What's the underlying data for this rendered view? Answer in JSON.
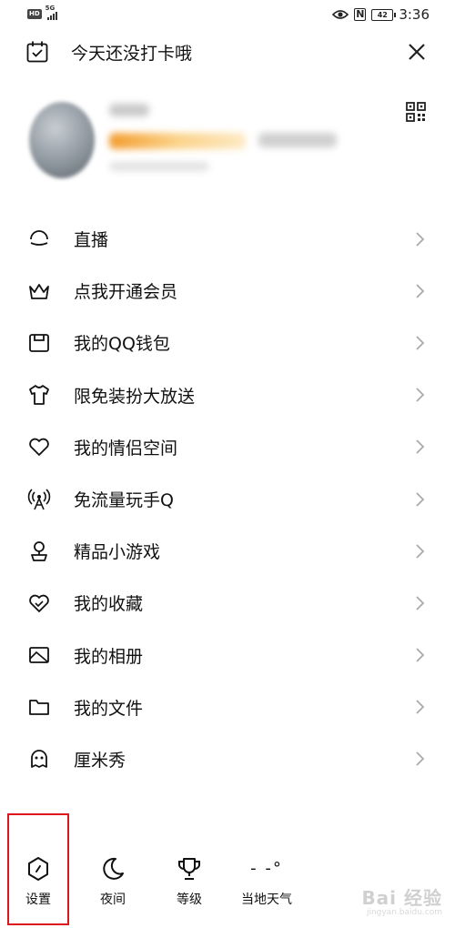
{
  "status_bar": {
    "hd": "HD",
    "network": "5G",
    "battery": "42",
    "time": "3:36"
  },
  "checkin": {
    "text": "今天还没打卡哦"
  },
  "menu": {
    "items": [
      {
        "label": "直播",
        "icon": "live-icon"
      },
      {
        "label": "点我开通会员",
        "icon": "crown-icon"
      },
      {
        "label": "我的QQ钱包",
        "icon": "wallet-icon"
      },
      {
        "label": "限免装扮大放送",
        "icon": "shirt-icon"
      },
      {
        "label": "我的情侣空间",
        "icon": "heart-icon"
      },
      {
        "label": "免流量玩手Q",
        "icon": "signal-tower-icon"
      },
      {
        "label": "精品小游戏",
        "icon": "game-icon"
      },
      {
        "label": "我的收藏",
        "icon": "favorite-icon"
      },
      {
        "label": "我的相册",
        "icon": "album-icon"
      },
      {
        "label": "我的文件",
        "icon": "folder-icon"
      },
      {
        "label": "厘米秀",
        "icon": "cmshow-icon"
      }
    ]
  },
  "bottom_bar": {
    "settings": "设置",
    "night": "夜间",
    "level": "等级",
    "weather": "当地天气",
    "weather_temp": "- -°"
  },
  "watermark": {
    "main": "Bai 经验",
    "sub": "jingyan.baidu.com"
  },
  "colors": {
    "highlight": "#e0161d",
    "vip_gold": "#f5a623"
  }
}
